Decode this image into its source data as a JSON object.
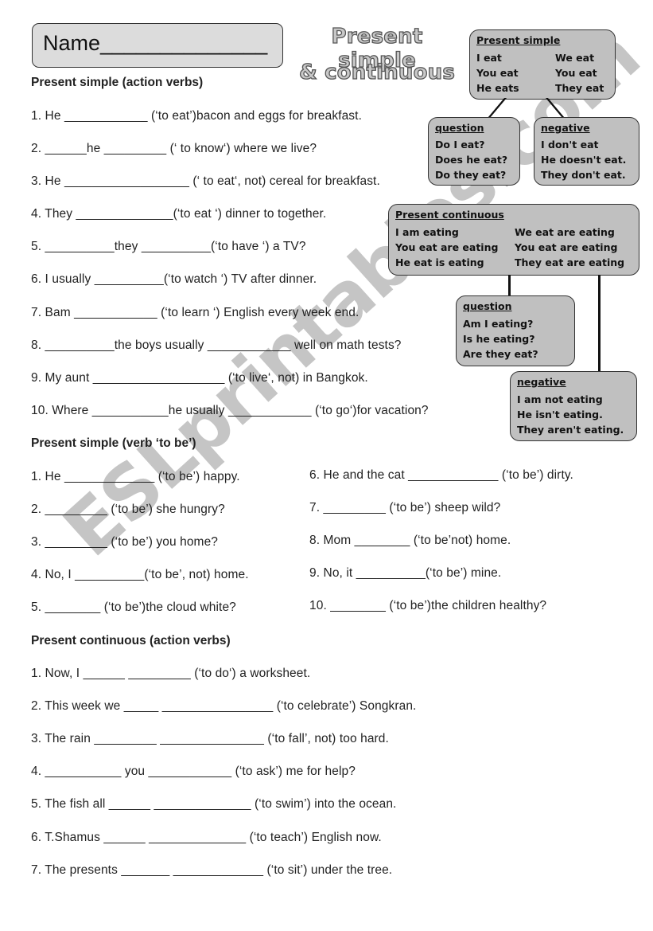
{
  "header": {
    "name_label": "Name______________",
    "title_line1": "Present simple",
    "title_line2": "& continuous"
  },
  "reference": {
    "present_simple": {
      "heading": "Present simple",
      "left": [
        "I eat",
        "You eat",
        "He eats"
      ],
      "right": [
        "We eat",
        "You eat",
        "They eat"
      ]
    },
    "ps_question": {
      "heading": "question",
      "lines": [
        "Do I eat?",
        "Does he eat?",
        "Do they eat?"
      ]
    },
    "ps_negative": {
      "heading": "negative",
      "lines": [
        "I don't eat",
        "He doesn't eat.",
        "They don't eat."
      ]
    },
    "present_continuous": {
      "heading": "Present continuous",
      "left": [
        "I am eating",
        "You eat are eating",
        "He eat is eating"
      ],
      "right": [
        "We eat are eating",
        "You eat are eating",
        "They eat are eating"
      ]
    },
    "pc_question": {
      "heading": "question",
      "lines": [
        "Am I eating?",
        "Is he eating?",
        "Are they eat?"
      ]
    },
    "pc_negative": {
      "heading": "negative",
      "lines": [
        "I am not eating",
        "He isn't eating.",
        "They aren't eating."
      ]
    }
  },
  "sections": [
    {
      "title": "Present simple (action verbs)",
      "items": [
        "1. He ____________ (‘to eat’)bacon and eggs for breakfast.",
        "2. ______he _________ (‘ to know‘) where we live?",
        "3. He __________________ (‘ to eat‘, not) cereal for breakfast.",
        "4. They ______________(‘to eat ‘) dinner to together.",
        "5. __________they __________(‘to have ‘) a TV?",
        "6. I usually __________(‘to watch ‘) TV after dinner.",
        "7. Bam ____________ (‘to learn ‘) English every week end.",
        "8. __________the boys usually ____________ well on math tests?",
        "9. My aunt ___________________ (‘to live‘, not) in Bangkok.",
        "10. Where ___________he usually ____________ (‘to go‘)for vacation?"
      ]
    },
    {
      "title": "Present simple (verb ‘to be’)",
      "items_left": [
        "1. He _____________ (‘to be’) happy.",
        "2. _________ (‘to be’) she hungry?",
        "3. _________ (‘to be’) you home?",
        "4. No, I __________(‘to be’, not) home.",
        "5. ________ (‘to be’)the cloud white?"
      ],
      "items_right": [
        "6. He and the cat _____________ (‘to be’) dirty.",
        "7. _________ (‘to be’) sheep wild?",
        "8. Mom ________ (‘to be’not) home.",
        "9. No, it __________(‘to be’) mine.",
        "10. ________ (‘to be’)the children healthy?"
      ]
    },
    {
      "title": "Present continuous (action verbs)",
      "items": [
        "1. Now, I ______ _________ (‘to do‘) a worksheet.",
        "2. This week we _____ ________________ (‘to celebrate’) Songkran.",
        "3. The rain _________ _______________ (‘to fall’, not) too hard.",
        "4. ___________ you ____________ (‘to ask’) me for help?",
        "5. The fish all ______ ______________ (‘to swim’) into the ocean.",
        "6. T.Shamus ______ ______________ (‘to teach’) English now.",
        "7. The presents _______ _____________ (‘to sit’) under the tree."
      ]
    }
  ],
  "watermark": "ESLprintables.com"
}
